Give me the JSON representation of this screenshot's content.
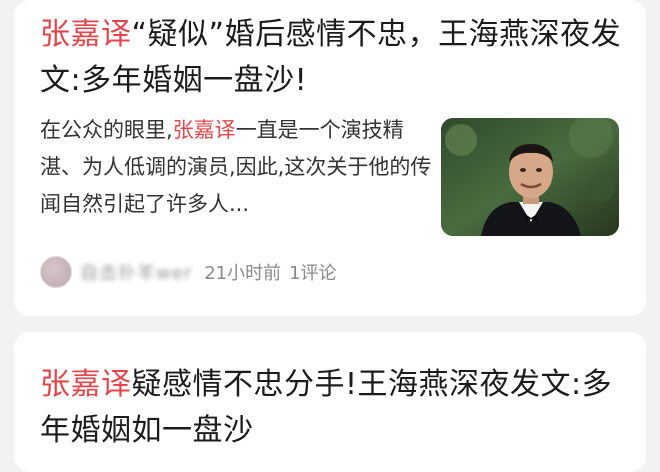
{
  "articles": [
    {
      "title_highlight": "张嘉译",
      "title_rest": "“疑似”婚后感情不忠，王海燕深夜发文:多年婚姻一盘沙!",
      "snippet_before": "在公众的眼里,",
      "snippet_highlight": "张嘉译",
      "snippet_after": "一直是一个演技精湛、为人低调的演员,因此,这次关于他的传闻自然引起了许多人...",
      "author": "自击扑羊wer",
      "time": "21小时前",
      "comments": "1评论",
      "thumbnail_icon": "man-in-tuxedo-photo"
    },
    {
      "title_highlight": "张嘉译",
      "title_rest": "疑感情不忠分手!王海燕深夜发文:多年婚姻如一盘沙"
    }
  ],
  "colors": {
    "highlight": "#e0474c",
    "background": "#f2f2f4",
    "card": "#ffffff"
  }
}
